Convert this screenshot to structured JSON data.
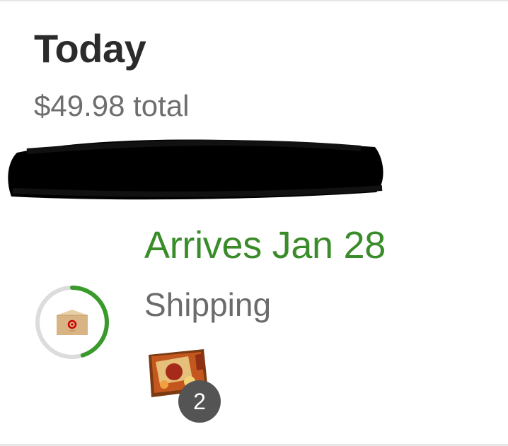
{
  "order": {
    "date_label": "Today",
    "total_text": "$49.98 total"
  },
  "shipment": {
    "arrival_text": "Arrives Jan 28",
    "status_text": "Shipping",
    "progress_fraction": 0.45,
    "item_count": "2",
    "package_icon": "package-box-icon",
    "accent_color": "#3a8c2a"
  }
}
